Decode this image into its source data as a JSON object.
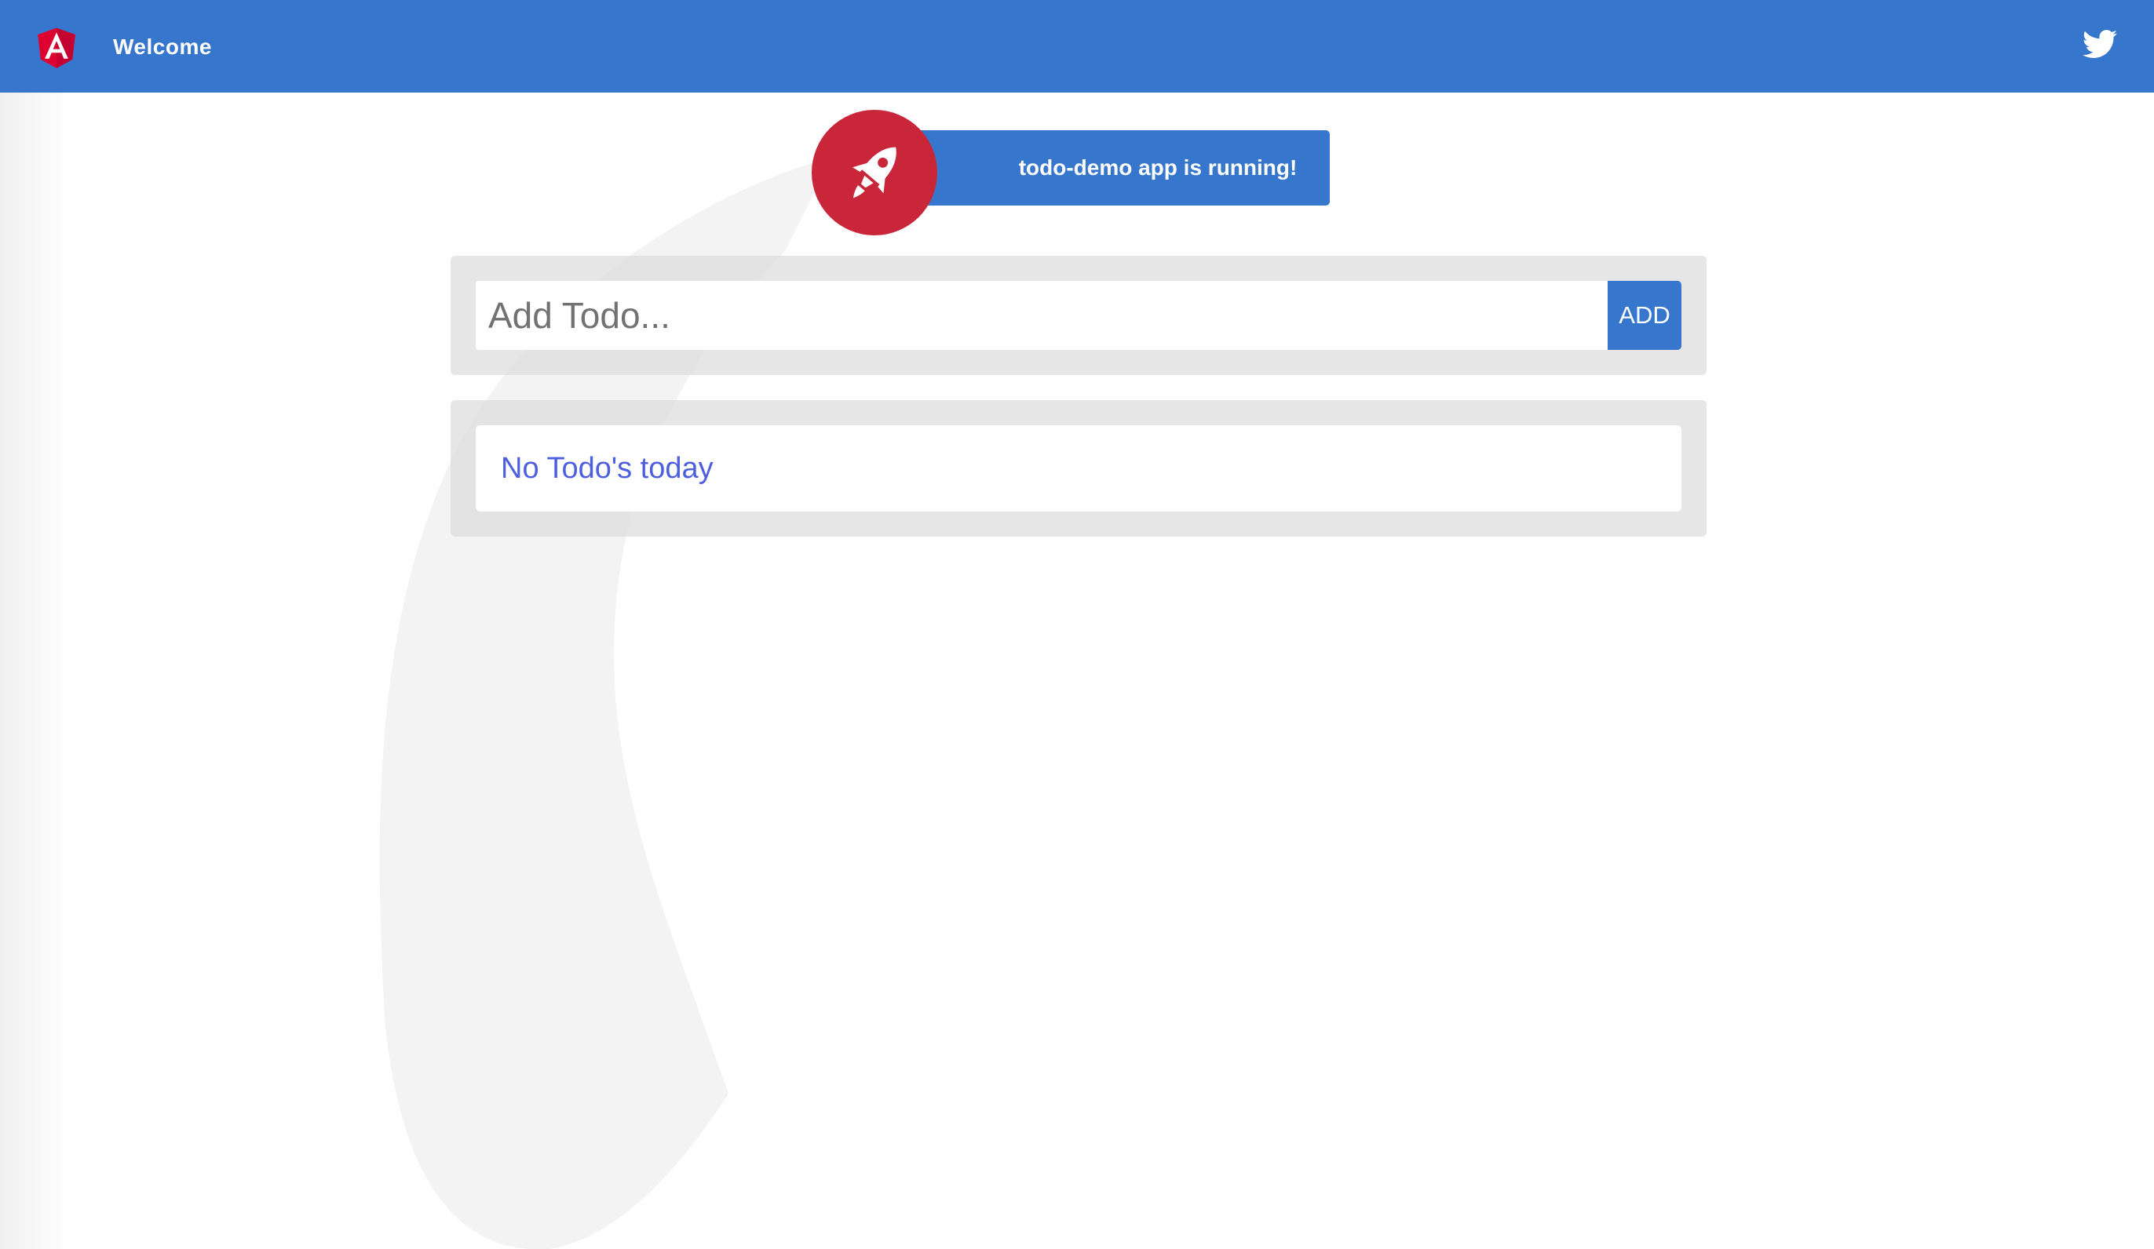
{
  "toolbar": {
    "logo_icon": "angular-logo-icon",
    "title": "Welcome",
    "twitter_icon": "twitter-icon"
  },
  "banner": {
    "icon": "rocket-icon",
    "text": "todo-demo app is running!"
  },
  "add_todo": {
    "placeholder": "Add Todo...",
    "value": "",
    "button_label": "ADD"
  },
  "todo_list": {
    "empty_message": "No Todo's today",
    "items": []
  },
  "colors": {
    "toolbar": "#3677cd",
    "accent": "#3677cd",
    "rocket_circle": "#c9263a",
    "angular_red": "#dd0031",
    "empty_text": "#4d5fdf",
    "panel": "#e6e6e6"
  }
}
